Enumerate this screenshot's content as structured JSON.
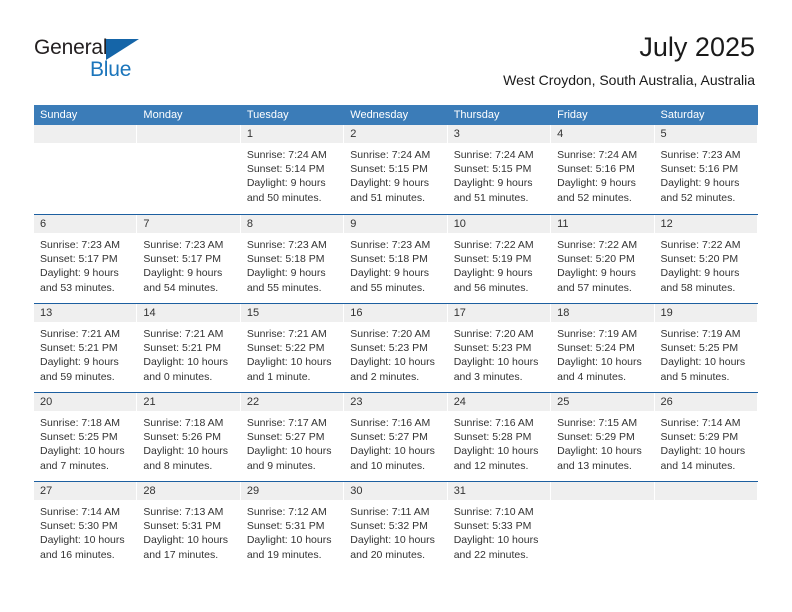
{
  "brand": {
    "name_part1": "General",
    "name_part2": "Blue"
  },
  "header": {
    "title": "July 2025",
    "subtitle": "West Croydon, South Australia, Australia"
  },
  "colors": {
    "header_blue": "#3b7cb8",
    "rule_blue": "#1d5fa0",
    "band_gray": "#efefef",
    "brand_blue": "#1b75bb",
    "text": "#333333"
  },
  "weekdays": [
    "Sunday",
    "Monday",
    "Tuesday",
    "Wednesday",
    "Thursday",
    "Friday",
    "Saturday"
  ],
  "weeks": [
    [
      {
        "empty": true
      },
      {
        "empty": true
      },
      {
        "day": "1",
        "sunrise": "Sunrise: 7:24 AM",
        "sunset": "Sunset: 5:14 PM",
        "daylight": "Daylight: 9 hours and 50 minutes."
      },
      {
        "day": "2",
        "sunrise": "Sunrise: 7:24 AM",
        "sunset": "Sunset: 5:15 PM",
        "daylight": "Daylight: 9 hours and 51 minutes."
      },
      {
        "day": "3",
        "sunrise": "Sunrise: 7:24 AM",
        "sunset": "Sunset: 5:15 PM",
        "daylight": "Daylight: 9 hours and 51 minutes."
      },
      {
        "day": "4",
        "sunrise": "Sunrise: 7:24 AM",
        "sunset": "Sunset: 5:16 PM",
        "daylight": "Daylight: 9 hours and 52 minutes."
      },
      {
        "day": "5",
        "sunrise": "Sunrise: 7:23 AM",
        "sunset": "Sunset: 5:16 PM",
        "daylight": "Daylight: 9 hours and 52 minutes."
      }
    ],
    [
      {
        "day": "6",
        "sunrise": "Sunrise: 7:23 AM",
        "sunset": "Sunset: 5:17 PM",
        "daylight": "Daylight: 9 hours and 53 minutes."
      },
      {
        "day": "7",
        "sunrise": "Sunrise: 7:23 AM",
        "sunset": "Sunset: 5:17 PM",
        "daylight": "Daylight: 9 hours and 54 minutes."
      },
      {
        "day": "8",
        "sunrise": "Sunrise: 7:23 AM",
        "sunset": "Sunset: 5:18 PM",
        "daylight": "Daylight: 9 hours and 55 minutes."
      },
      {
        "day": "9",
        "sunrise": "Sunrise: 7:23 AM",
        "sunset": "Sunset: 5:18 PM",
        "daylight": "Daylight: 9 hours and 55 minutes."
      },
      {
        "day": "10",
        "sunrise": "Sunrise: 7:22 AM",
        "sunset": "Sunset: 5:19 PM",
        "daylight": "Daylight: 9 hours and 56 minutes."
      },
      {
        "day": "11",
        "sunrise": "Sunrise: 7:22 AM",
        "sunset": "Sunset: 5:20 PM",
        "daylight": "Daylight: 9 hours and 57 minutes."
      },
      {
        "day": "12",
        "sunrise": "Sunrise: 7:22 AM",
        "sunset": "Sunset: 5:20 PM",
        "daylight": "Daylight: 9 hours and 58 minutes."
      }
    ],
    [
      {
        "day": "13",
        "sunrise": "Sunrise: 7:21 AM",
        "sunset": "Sunset: 5:21 PM",
        "daylight": "Daylight: 9 hours and 59 minutes."
      },
      {
        "day": "14",
        "sunrise": "Sunrise: 7:21 AM",
        "sunset": "Sunset: 5:21 PM",
        "daylight": "Daylight: 10 hours and 0 minutes."
      },
      {
        "day": "15",
        "sunrise": "Sunrise: 7:21 AM",
        "sunset": "Sunset: 5:22 PM",
        "daylight": "Daylight: 10 hours and 1 minute."
      },
      {
        "day": "16",
        "sunrise": "Sunrise: 7:20 AM",
        "sunset": "Sunset: 5:23 PM",
        "daylight": "Daylight: 10 hours and 2 minutes."
      },
      {
        "day": "17",
        "sunrise": "Sunrise: 7:20 AM",
        "sunset": "Sunset: 5:23 PM",
        "daylight": "Daylight: 10 hours and 3 minutes."
      },
      {
        "day": "18",
        "sunrise": "Sunrise: 7:19 AM",
        "sunset": "Sunset: 5:24 PM",
        "daylight": "Daylight: 10 hours and 4 minutes."
      },
      {
        "day": "19",
        "sunrise": "Sunrise: 7:19 AM",
        "sunset": "Sunset: 5:25 PM",
        "daylight": "Daylight: 10 hours and 5 minutes."
      }
    ],
    [
      {
        "day": "20",
        "sunrise": "Sunrise: 7:18 AM",
        "sunset": "Sunset: 5:25 PM",
        "daylight": "Daylight: 10 hours and 7 minutes."
      },
      {
        "day": "21",
        "sunrise": "Sunrise: 7:18 AM",
        "sunset": "Sunset: 5:26 PM",
        "daylight": "Daylight: 10 hours and 8 minutes."
      },
      {
        "day": "22",
        "sunrise": "Sunrise: 7:17 AM",
        "sunset": "Sunset: 5:27 PM",
        "daylight": "Daylight: 10 hours and 9 minutes."
      },
      {
        "day": "23",
        "sunrise": "Sunrise: 7:16 AM",
        "sunset": "Sunset: 5:27 PM",
        "daylight": "Daylight: 10 hours and 10 minutes."
      },
      {
        "day": "24",
        "sunrise": "Sunrise: 7:16 AM",
        "sunset": "Sunset: 5:28 PM",
        "daylight": "Daylight: 10 hours and 12 minutes."
      },
      {
        "day": "25",
        "sunrise": "Sunrise: 7:15 AM",
        "sunset": "Sunset: 5:29 PM",
        "daylight": "Daylight: 10 hours and 13 minutes."
      },
      {
        "day": "26",
        "sunrise": "Sunrise: 7:14 AM",
        "sunset": "Sunset: 5:29 PM",
        "daylight": "Daylight: 10 hours and 14 minutes."
      }
    ],
    [
      {
        "day": "27",
        "sunrise": "Sunrise: 7:14 AM",
        "sunset": "Sunset: 5:30 PM",
        "daylight": "Daylight: 10 hours and 16 minutes."
      },
      {
        "day": "28",
        "sunrise": "Sunrise: 7:13 AM",
        "sunset": "Sunset: 5:31 PM",
        "daylight": "Daylight: 10 hours and 17 minutes."
      },
      {
        "day": "29",
        "sunrise": "Sunrise: 7:12 AM",
        "sunset": "Sunset: 5:31 PM",
        "daylight": "Daylight: 10 hours and 19 minutes."
      },
      {
        "day": "30",
        "sunrise": "Sunrise: 7:11 AM",
        "sunset": "Sunset: 5:32 PM",
        "daylight": "Daylight: 10 hours and 20 minutes."
      },
      {
        "day": "31",
        "sunrise": "Sunrise: 7:10 AM",
        "sunset": "Sunset: 5:33 PM",
        "daylight": "Daylight: 10 hours and 22 minutes."
      },
      {
        "empty": true
      },
      {
        "empty": true
      }
    ]
  ]
}
